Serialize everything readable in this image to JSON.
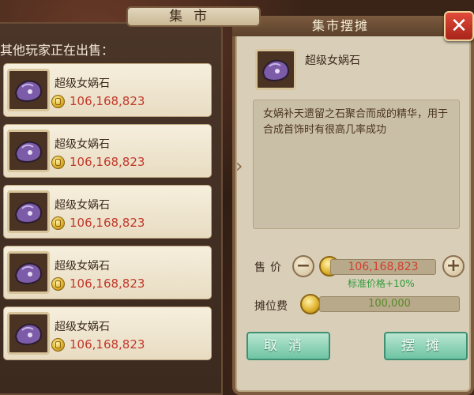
{
  "left": {
    "tab_title": "集市",
    "header": "其他玩家正在出售：",
    "listings": [
      {
        "name": "超级女娲石",
        "price": "106,168,823"
      },
      {
        "name": "超级女娲石",
        "price": "106,168,823"
      },
      {
        "name": "超级女娲石",
        "price": "106,168,823"
      },
      {
        "name": "超级女娲石",
        "price": "106,168,823"
      },
      {
        "name": "超级女娲石",
        "price": "106,168,823"
      }
    ]
  },
  "dialog": {
    "title": "集市摆摊",
    "close_icon": "close-icon",
    "item_name": "超级女娲石",
    "description": "女娲补天遗留之石聚合而成的精华，用于合成首饰时有很高几率成功",
    "price_label": "售价",
    "price_value": "106,168,823",
    "reference_price": "标准价格+10%",
    "fee_label": "摊位费",
    "fee_value": "100,000",
    "cancel_label": "取消",
    "confirm_label": "摆摊"
  },
  "colors": {
    "price_red": "#c2392b",
    "ref_green": "#2f9a3a",
    "button_teal": "#6ec4a3",
    "close_red": "#c03020"
  }
}
